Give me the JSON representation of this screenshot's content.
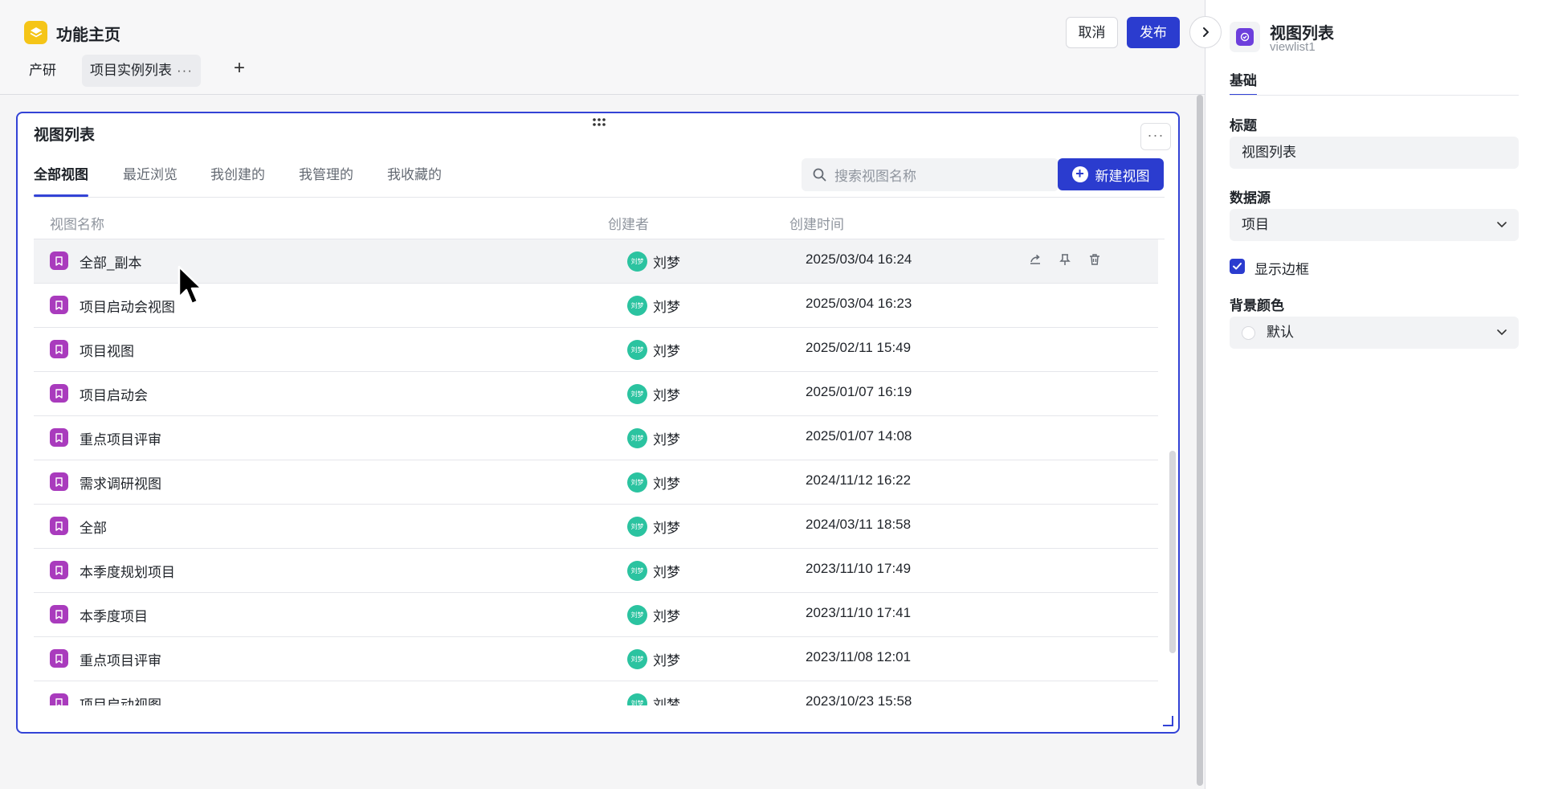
{
  "app": {
    "title": "功能主页"
  },
  "page_tabs": [
    {
      "label": "产研"
    },
    {
      "label": "项目实例列表",
      "more": "···"
    }
  ],
  "add_tab_label": "+",
  "header_actions": {
    "cancel_label": "取消",
    "publish_label": "发布"
  },
  "widget": {
    "title": "视图列表",
    "more_label": "···",
    "tabs": [
      {
        "label": "全部视图",
        "active": true
      },
      {
        "label": "最近浏览"
      },
      {
        "label": "我创建的"
      },
      {
        "label": "我管理的"
      },
      {
        "label": "我收藏的"
      }
    ],
    "search_placeholder": "搜索视图名称",
    "new_view_label": "新建视图",
    "columns": {
      "name": "视图名称",
      "creator": "创建者",
      "time": "创建时间"
    },
    "rows": [
      {
        "name": "全部_副本",
        "avatar": "刘梦",
        "creator": "刘梦",
        "time": "2025/03/04 16:24"
      },
      {
        "name": "项目启动会视图",
        "avatar": "刘梦",
        "creator": "刘梦",
        "time": "2025/03/04 16:23"
      },
      {
        "name": "项目视图",
        "avatar": "刘梦",
        "creator": "刘梦",
        "time": "2025/02/11 15:49"
      },
      {
        "name": "项目启动会",
        "avatar": "刘梦",
        "creator": "刘梦",
        "time": "2025/01/07 16:19"
      },
      {
        "name": "重点项目评审",
        "avatar": "刘梦",
        "creator": "刘梦",
        "time": "2025/01/07 14:08"
      },
      {
        "name": "需求调研视图",
        "avatar": "刘梦",
        "creator": "刘梦",
        "time": "2024/11/12 16:22"
      },
      {
        "name": "全部",
        "avatar": "刘梦",
        "creator": "刘梦",
        "time": "2024/03/11 18:58"
      },
      {
        "name": "本季度规划项目",
        "avatar": "刘梦",
        "creator": "刘梦",
        "time": "2023/11/10 17:49"
      },
      {
        "name": "本季度项目",
        "avatar": "刘梦",
        "creator": "刘梦",
        "time": "2023/11/10 17:41"
      },
      {
        "name": "重点项目评审",
        "avatar": "刘梦",
        "creator": "刘梦",
        "time": "2023/11/08 12:01"
      },
      {
        "name": "项目启动视图",
        "avatar": "刘梦",
        "creator": "刘梦",
        "time": "2023/10/23 15:58"
      }
    ]
  },
  "panel": {
    "title": "视图列表",
    "subtitle": "viewlist1",
    "tab": "基础",
    "title_label": "标题",
    "title_value": "视图列表",
    "datasource_label": "数据源",
    "datasource_value": "项目",
    "show_border_label": "显示边框",
    "show_border_checked": true,
    "bg_color_label": "背景颜色",
    "bg_color_value": "默认"
  },
  "colors": {
    "accent": "#2b3ccf",
    "row_icon": "#a93bbd",
    "avatar": "#2bc3a0",
    "logo": "#f5c518"
  }
}
